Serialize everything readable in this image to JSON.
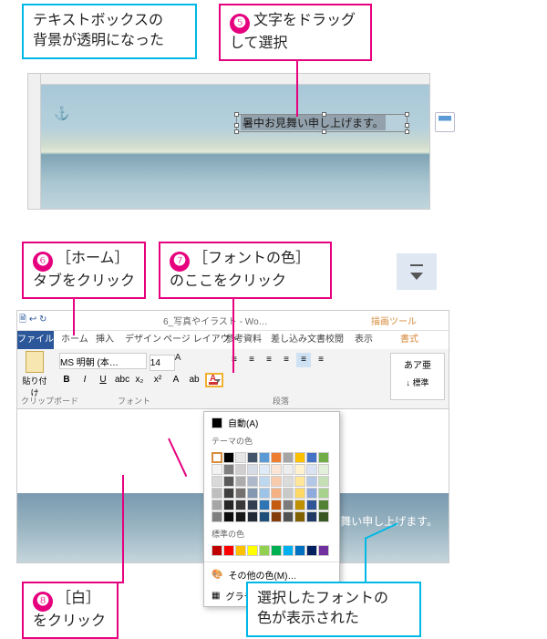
{
  "callouts": {
    "a": "テキストボックスの\n背景が透明になった",
    "b_num": "❺",
    "b_text": "文字をドラッグして選択",
    "c_num": "❻",
    "c_text": "［ホーム］タブをクリック",
    "d_num": "❼",
    "d_text": "［フォントの色］のここをクリック",
    "e_num": "❽",
    "e_text": "［白］をクリック",
    "f": "選択したフォントの\n色が表示された"
  },
  "shot1": {
    "anchor": "⚓",
    "text": "暑中お見舞い申し上げます。"
  },
  "word": {
    "qa_icons": "🗎 ↩ ↻",
    "filename": "6_写真やイラスト - Wo…",
    "context_tool": "描画ツール",
    "tabs": {
      "file": "ファイル",
      "home": "ホーム",
      "insert": "挿入",
      "design": "デザイン",
      "layout": "ページ レイアウト",
      "ref": "参考資料",
      "mail": "差し込み文書",
      "review": "校閲",
      "view": "表示",
      "format": "書式"
    },
    "ribbon": {
      "paste": "貼り付け",
      "clipboard": "クリップボード",
      "font_group": "フォント",
      "para_group": "段落",
      "font_name": "MS 明朝 (本…",
      "font_size": "14",
      "bold": "B",
      "italic": "I",
      "underline": "U",
      "style_sample": "あア亜",
      "style_name": "↓ 標準"
    },
    "colormenu": {
      "auto": "自動(A)",
      "theme": "テーマの色",
      "standard": "標準の色",
      "more": "その他の色(M)…",
      "gradient": "グラデーション(G)"
    },
    "doc_text": "暑中お見舞い申し上げます。"
  }
}
